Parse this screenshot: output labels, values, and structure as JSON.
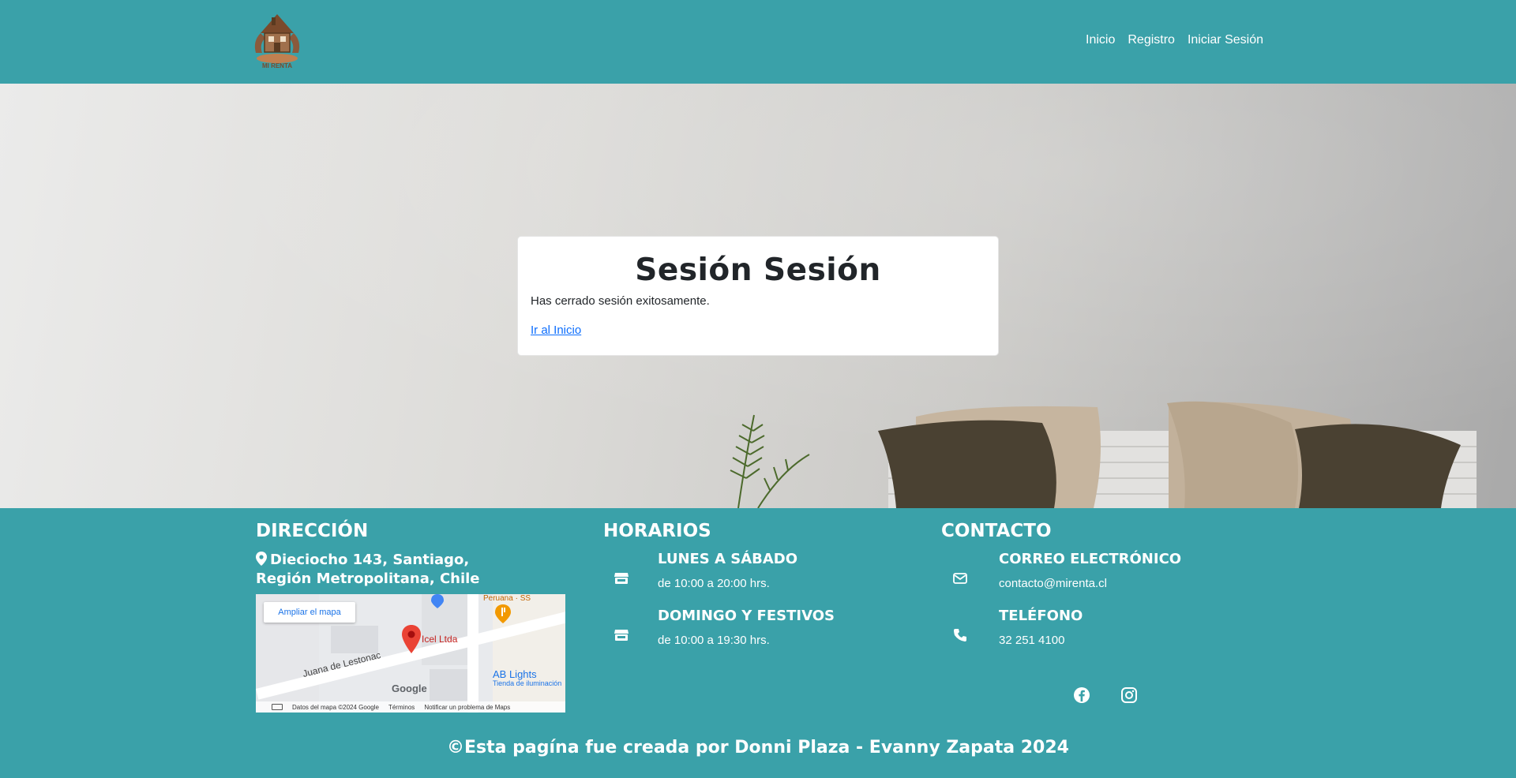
{
  "nav": {
    "logo_text": "MI RENTA",
    "links": [
      {
        "label": "Inicio"
      },
      {
        "label": "Registro"
      },
      {
        "label": "Iniciar Sesión"
      }
    ]
  },
  "card": {
    "title": "Sesión Sesión",
    "message": "Has cerrado sesión exitosamente.",
    "link_label": "Ir al Inicio"
  },
  "footer": {
    "direccion": {
      "title": "DIRECCIÓN",
      "address": "Dieciocho 143, Santiago, Región Metropolitana, Chile",
      "map": {
        "expand_button": "Ampliar el mapa",
        "place_label": "Icel Ltda",
        "street_label": "Juana de Lestonac",
        "poi_1": "Peruana · SS",
        "poi_2": "AB Lights",
        "poi_2_sub": "Tienda de iluminación",
        "brand": "Google",
        "attrib_data": "Datos del mapa ©2024 Google",
        "attrib_terms": "Términos",
        "attrib_report": "Notificar un problema de Maps"
      }
    },
    "horarios": {
      "title": "HORARIOS",
      "items": [
        {
          "title": "LUNES A SÁBADO",
          "text": "de 10:00 a 20:00 hrs."
        },
        {
          "title": "DOMINGO Y FESTIVOS",
          "text": "de 10:00 a 19:30 hrs."
        }
      ]
    },
    "contacto": {
      "title": "CONTACTO",
      "items": [
        {
          "title": "CORREO ELECTRÓNICO",
          "text": "contacto@mirenta.cl",
          "icon": "envelope-icon"
        },
        {
          "title": "TELÉFONO",
          "text": "32 251 4100",
          "icon": "phone-icon"
        }
      ]
    },
    "copyright": "©Esta pagína fue creada por Donni Plaza - Evanny Zapata 2024"
  },
  "colors": {
    "brand": "#3aa1a9",
    "card_bg": "#ffffff",
    "link": "#0d6efd"
  }
}
